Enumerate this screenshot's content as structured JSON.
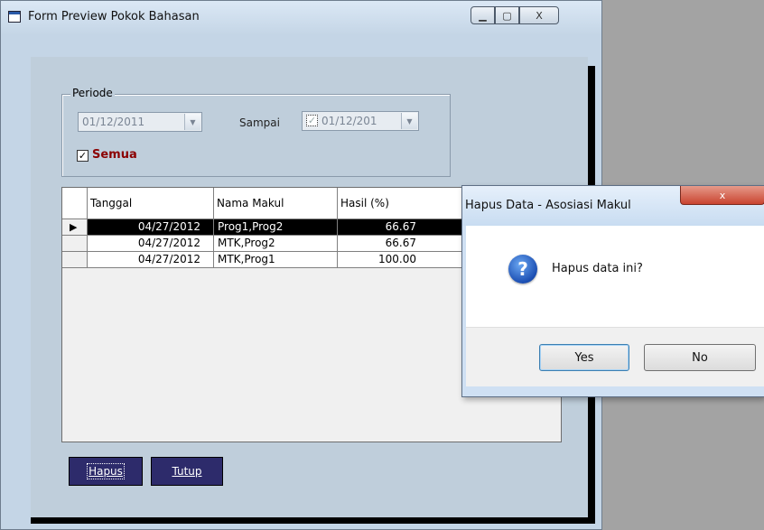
{
  "window": {
    "title": "Form Preview Pokok Bahasan",
    "min_glyph": "▁",
    "max_glyph": "▢",
    "close_glyph": "X"
  },
  "periode": {
    "legend": "Periode",
    "from_date": "01/12/2011",
    "sampai_label": "Sampai",
    "to_date": "01/12/201",
    "to_checked_glyph": "✓",
    "semua_label": "Semua",
    "semua_checked_glyph": "✓",
    "dropdown_glyph": "▼"
  },
  "grid": {
    "columns": [
      "Tanggal",
      "Nama Makul",
      "Hasil (%)"
    ],
    "rows": [
      {
        "tanggal": "04/27/2012",
        "nama_makul": "Prog1,Prog2",
        "hasil": "66.67"
      },
      {
        "tanggal": "04/27/2012",
        "nama_makul": "MTK,Prog2",
        "hasil": "66.67"
      },
      {
        "tanggal": "04/27/2012",
        "nama_makul": "MTK,Prog1",
        "hasil": "100.00"
      }
    ],
    "row_pointer_glyph": "▶"
  },
  "buttons": {
    "hapus": "Hapus",
    "tutup": "Tutup"
  },
  "dialog": {
    "title": "Hapus Data - Asosiasi Makul",
    "close_glyph": "x",
    "message": "Hapus data ini?",
    "icon_glyph": "?",
    "yes": "Yes",
    "no": "No"
  }
}
